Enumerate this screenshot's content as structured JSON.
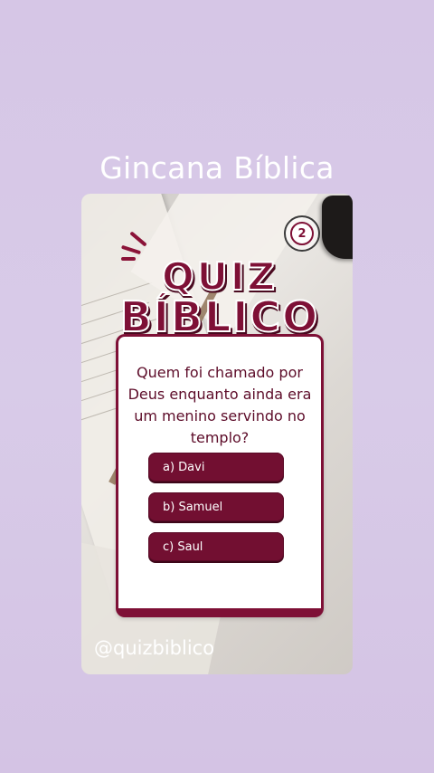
{
  "header": {
    "title": "Gincana Bíblica"
  },
  "card": {
    "badge_number": "2",
    "logo": {
      "line1": "QUIZ",
      "line2": "BÍBLICO"
    },
    "question": "Quem foi chamado por Deus enquanto ainda era um menino servindo no templo?",
    "answers": [
      {
        "label": "a) Davi"
      },
      {
        "label": "b) Samuel"
      },
      {
        "label": "c) Saul"
      }
    ]
  },
  "footer": {
    "handle": "@quizbiblico"
  },
  "colors": {
    "accent": "#7e1036",
    "background": "#d6c6e6",
    "text_light": "#ffffff"
  }
}
